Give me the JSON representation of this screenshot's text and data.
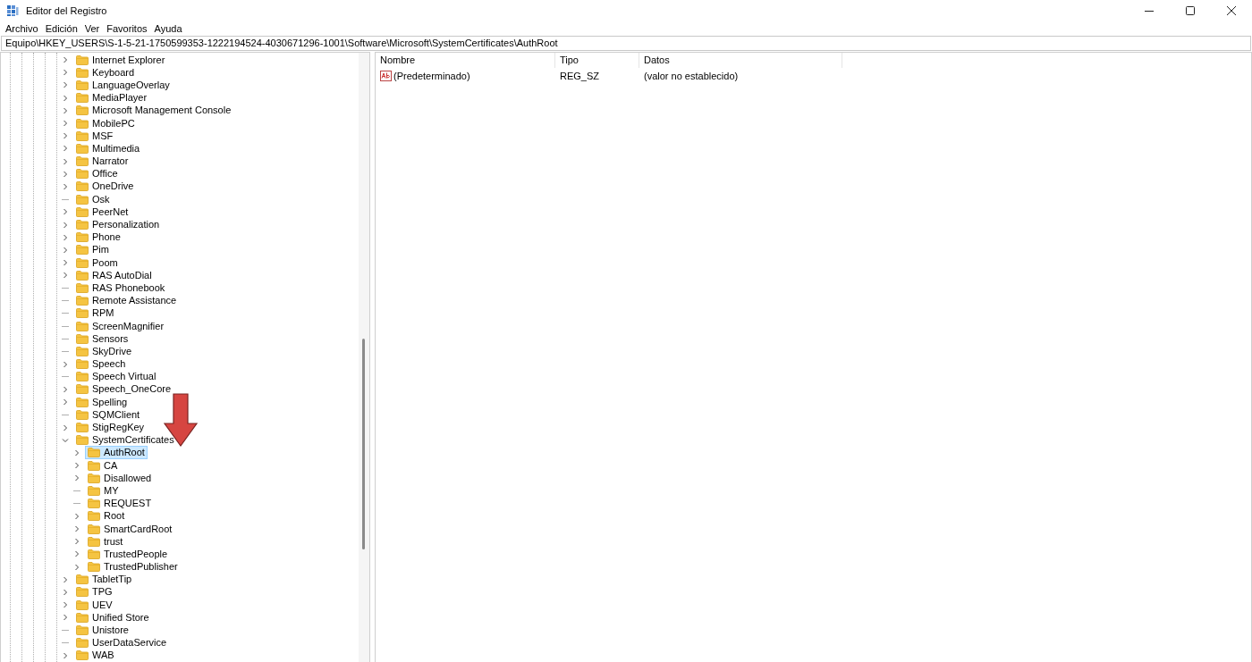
{
  "window": {
    "title": "Editor del Registro"
  },
  "menu": [
    "Archivo",
    "Edición",
    "Ver",
    "Favoritos",
    "Ayuda"
  ],
  "address": "Equipo\\HKEY_USERS\\S-1-5-21-1750599353-1222194524-4030671296-1001\\Software\\Microsoft\\SystemCertificates\\AuthRoot",
  "tree": [
    {
      "label": "Internet Explorer",
      "expandable": true,
      "expanded": false,
      "selected": false
    },
    {
      "label": "Keyboard",
      "expandable": true,
      "expanded": false,
      "selected": false
    },
    {
      "label": "LanguageOverlay",
      "expandable": true,
      "expanded": false,
      "selected": false
    },
    {
      "label": "MediaPlayer",
      "expandable": true,
      "expanded": false,
      "selected": false
    },
    {
      "label": "Microsoft Management Console",
      "expandable": true,
      "expanded": false,
      "selected": false
    },
    {
      "label": "MobilePC",
      "expandable": true,
      "expanded": false,
      "selected": false
    },
    {
      "label": "MSF",
      "expandable": true,
      "expanded": false,
      "selected": false
    },
    {
      "label": "Multimedia",
      "expandable": true,
      "expanded": false,
      "selected": false
    },
    {
      "label": "Narrator",
      "expandable": true,
      "expanded": false,
      "selected": false
    },
    {
      "label": "Office",
      "expandable": true,
      "expanded": false,
      "selected": false
    },
    {
      "label": "OneDrive",
      "expandable": true,
      "expanded": false,
      "selected": false
    },
    {
      "label": "Osk",
      "expandable": false,
      "selected": false
    },
    {
      "label": "PeerNet",
      "expandable": true,
      "expanded": false,
      "selected": false
    },
    {
      "label": "Personalization",
      "expandable": true,
      "expanded": false,
      "selected": false
    },
    {
      "label": "Phone",
      "expandable": true,
      "expanded": false,
      "selected": false
    },
    {
      "label": "Pim",
      "expandable": true,
      "expanded": false,
      "selected": false
    },
    {
      "label": "Poom",
      "expandable": true,
      "expanded": false,
      "selected": false
    },
    {
      "label": "RAS AutoDial",
      "expandable": true,
      "expanded": false,
      "selected": false
    },
    {
      "label": "RAS Phonebook",
      "expandable": false,
      "selected": false
    },
    {
      "label": "Remote Assistance",
      "expandable": false,
      "selected": false
    },
    {
      "label": "RPM",
      "expandable": false,
      "selected": false
    },
    {
      "label": "ScreenMagnifier",
      "expandable": false,
      "selected": false
    },
    {
      "label": "Sensors",
      "expandable": false,
      "selected": false
    },
    {
      "label": "SkyDrive",
      "expandable": false,
      "selected": false
    },
    {
      "label": "Speech",
      "expandable": true,
      "expanded": false,
      "selected": false
    },
    {
      "label": "Speech Virtual",
      "expandable": false,
      "selected": false
    },
    {
      "label": "Speech_OneCore",
      "expandable": true,
      "expanded": false,
      "selected": false
    },
    {
      "label": "Spelling",
      "expandable": true,
      "expanded": false,
      "selected": false
    },
    {
      "label": "SQMClient",
      "expandable": false,
      "selected": false
    },
    {
      "label": "StigRegKey",
      "expandable": true,
      "expanded": false,
      "selected": false
    },
    {
      "label": "SystemCertificates",
      "expandable": true,
      "expanded": true,
      "selected": false,
      "children": [
        {
          "label": "AuthRoot",
          "expandable": true,
          "expanded": false,
          "selected": true
        },
        {
          "label": "CA",
          "expandable": true,
          "expanded": false,
          "selected": false
        },
        {
          "label": "Disallowed",
          "expandable": true,
          "expanded": false,
          "selected": false
        },
        {
          "label": "MY",
          "expandable": false,
          "selected": false
        },
        {
          "label": "REQUEST",
          "expandable": false,
          "selected": false
        },
        {
          "label": "Root",
          "expandable": true,
          "expanded": false,
          "selected": false
        },
        {
          "label": "SmartCardRoot",
          "expandable": true,
          "expanded": false,
          "selected": false
        },
        {
          "label": "trust",
          "expandable": true,
          "expanded": false,
          "selected": false
        },
        {
          "label": "TrustedPeople",
          "expandable": true,
          "expanded": false,
          "selected": false
        },
        {
          "label": "TrustedPublisher",
          "expandable": true,
          "expanded": false,
          "selected": false
        }
      ]
    },
    {
      "label": "TabletTip",
      "expandable": true,
      "expanded": false,
      "selected": false
    },
    {
      "label": "TPG",
      "expandable": true,
      "expanded": false,
      "selected": false
    },
    {
      "label": "UEV",
      "expandable": true,
      "expanded": false,
      "selected": false
    },
    {
      "label": "Unified Store",
      "expandable": true,
      "expanded": false,
      "selected": false
    },
    {
      "label": "Unistore",
      "expandable": false,
      "selected": false
    },
    {
      "label": "UserDataService",
      "expandable": false,
      "selected": false
    },
    {
      "label": "WAB",
      "expandable": true,
      "expanded": false,
      "selected": false
    }
  ],
  "values": {
    "columns": [
      "Nombre",
      "Tipo",
      "Datos"
    ],
    "rows": [
      {
        "name": "(Predeterminado)",
        "type": "REG_SZ",
        "data": "(valor no establecido)"
      }
    ]
  }
}
